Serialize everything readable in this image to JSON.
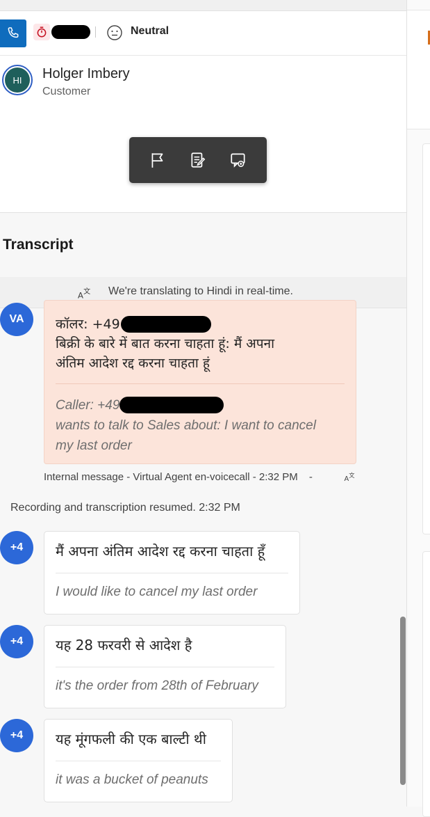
{
  "call_bar": {
    "phone_icon": "phone-icon",
    "timer_icon": "stopwatch-icon",
    "sentiment_icon": "neutral-face-icon",
    "sentiment_label": "Neutral"
  },
  "customer": {
    "initials": "HI",
    "name": "Holger Imbery",
    "role": "Customer"
  },
  "toolbar": {
    "items": [
      "flag-icon",
      "notes-icon",
      "consult-icon"
    ]
  },
  "transcript": {
    "title": "Transcript",
    "translation_banner": "We're translating to Hindi in real-time."
  },
  "internal_message": {
    "badge": "VA",
    "original_line1": "कॉलर: +49",
    "original_line2": "बिक्री के बारे में बात करना चाहता हूं: मैं अपना",
    "original_line3": "अंतिम आदेश रद्द करना चाहता हूं",
    "translated_line1": "Caller: +49",
    "translated_line2": "wants to talk to Sales  about: I want to cancel",
    "translated_line3": "my last order",
    "meta": "Internal message - Virtual Agent en-voicecall - 2:32 PM",
    "meta_dash": "-"
  },
  "status": {
    "text": "Recording and transcription resumed. 2:32 PM"
  },
  "messages": [
    {
      "badge": "+4",
      "original": "मैं अपना अंतिम आदेश रद्द करना चाहता हूँ",
      "translated": "I would like to cancel my last order"
    },
    {
      "badge": "+4",
      "original": "यह 28 फरवरी से आदेश है",
      "translated": "it's the order from 28th of February"
    },
    {
      "badge": "+4",
      "original": "यह मूंगफली की एक बाल्टी थी",
      "translated": "it was a bucket of peanuts"
    }
  ],
  "colors": {
    "accent": "#0f6cbd",
    "badge": "#2c68d8",
    "internal_card": "#fce4da",
    "toolbar": "#3b3b3b"
  }
}
